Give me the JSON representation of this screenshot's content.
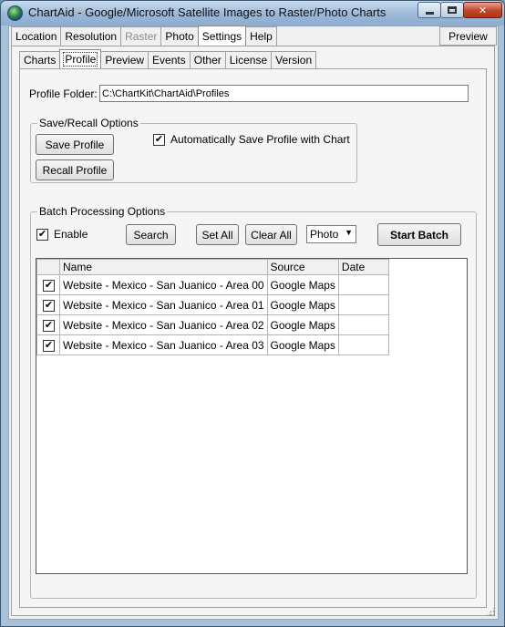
{
  "window": {
    "title": "ChartAid - Google/Microsoft Satellite Images to Raster/Photo Charts"
  },
  "main_tabs": [
    {
      "label": "Location",
      "state": "normal"
    },
    {
      "label": "Resolution",
      "state": "normal"
    },
    {
      "label": "Raster",
      "state": "disabled"
    },
    {
      "label": "Photo",
      "state": "normal"
    },
    {
      "label": "Settings",
      "state": "active"
    },
    {
      "label": "Help",
      "state": "normal"
    }
  ],
  "preview_label": "Preview",
  "settings_tabs": [
    {
      "label": "Charts",
      "state": "normal"
    },
    {
      "label": "Profile",
      "state": "active"
    },
    {
      "label": "Preview",
      "state": "normal"
    },
    {
      "label": "Events",
      "state": "normal"
    },
    {
      "label": "Other",
      "state": "normal"
    },
    {
      "label": "License",
      "state": "normal"
    },
    {
      "label": "Version",
      "state": "normal"
    }
  ],
  "profile": {
    "folder_label": "Profile Folder:",
    "folder_value": "C:\\ChartKit\\ChartAid\\Profiles"
  },
  "save_recall": {
    "legend": "Save/Recall Options",
    "save_label": "Save Profile",
    "recall_label": "Recall Profile",
    "auto_save_label": "Automatically Save Profile with Chart",
    "auto_save_checked": true
  },
  "batch": {
    "legend": "Batch Processing Options",
    "enable_label": "Enable",
    "enable_checked": true,
    "search_label": "Search",
    "set_all_label": "Set All",
    "clear_all_label": "Clear All",
    "type_value": "Photo",
    "start_label": "Start Batch",
    "columns": [
      "",
      "Name",
      "Source",
      "Date"
    ],
    "rows": [
      {
        "checked": true,
        "name": "Website - Mexico - San Juanico - Area 00",
        "source": "Google Maps",
        "date": ""
      },
      {
        "checked": true,
        "name": "Website - Mexico - San Juanico - Area 01",
        "source": "Google Maps",
        "date": ""
      },
      {
        "checked": true,
        "name": "Website - Mexico - San Juanico - Area 02",
        "source": "Google Maps",
        "date": ""
      },
      {
        "checked": true,
        "name": "Website - Mexico - San Juanico - Area 03",
        "source": "Google Maps",
        "date": ""
      }
    ]
  },
  "colors": {
    "window_frame": "#a9c2dc",
    "close_button": "#c0442a",
    "client_bg": "#f0f0f0"
  }
}
